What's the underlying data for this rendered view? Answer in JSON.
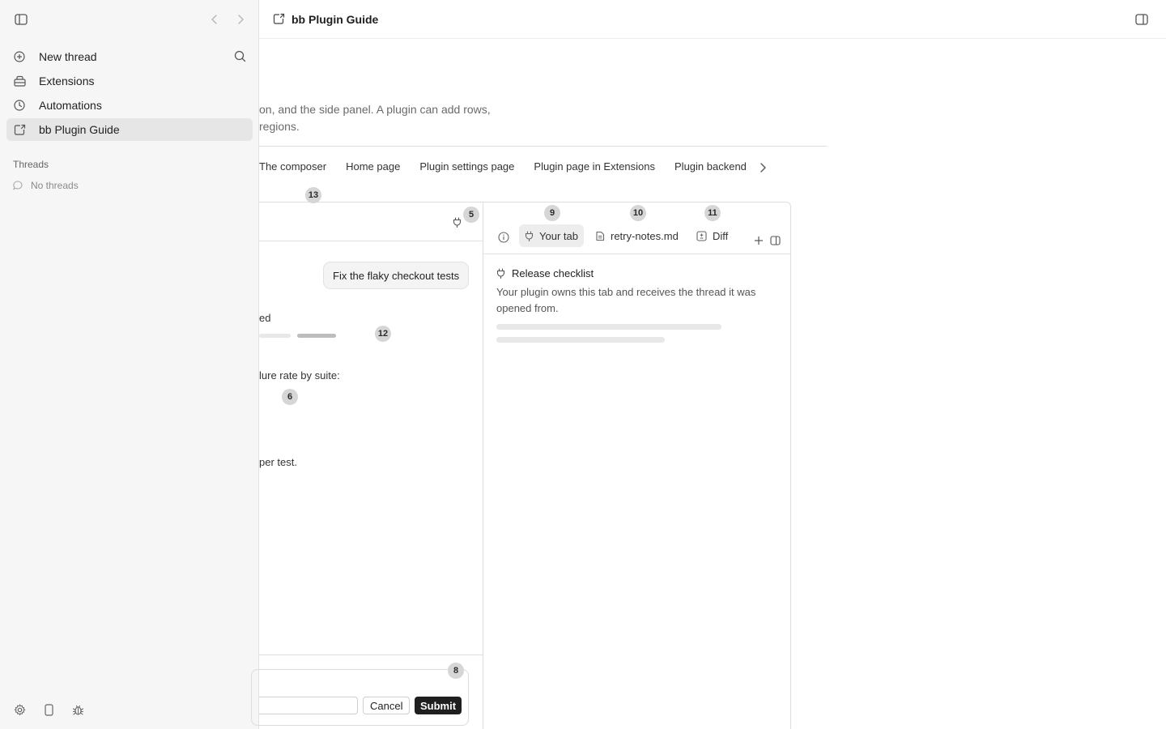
{
  "sidebar": {
    "nav": [
      {
        "label": "New thread",
        "icon": "plus-circle-icon"
      },
      {
        "label": "Extensions",
        "icon": "extensions-icon"
      },
      {
        "label": "Automations",
        "icon": "clock-icon"
      },
      {
        "label": "bb Plugin Guide",
        "icon": "plugin-page-icon",
        "active": true
      }
    ],
    "threads_heading": "Threads",
    "no_threads": "No threads"
  },
  "header": {
    "title": "bb Plugin Guide"
  },
  "main": {
    "description_line1": "on, and the side panel. A plugin can add rows,",
    "description_line2": "regions.",
    "tabs": [
      {
        "label": "The composer"
      },
      {
        "label": "Home page"
      },
      {
        "label": "Plugin settings page"
      },
      {
        "label": "Plugin page in Extensions"
      },
      {
        "label": "Plugin backend"
      }
    ]
  },
  "badges": {
    "b5": "5",
    "b6": "6",
    "b8": "8",
    "b9": "9",
    "b10": "10",
    "b11": "11",
    "b12": "12",
    "b13": "13"
  },
  "thread_preview": {
    "user_message": "Fix the flaky checkout tests",
    "fragment_1": "ed",
    "fragment_2": "lure rate by suite:",
    "fragment_3": "per test.",
    "composer": {
      "cancel_label": "Cancel",
      "submit_label": "Submit"
    }
  },
  "side_panel": {
    "tabs": [
      {
        "label": "Your tab",
        "icon": "plug-icon",
        "active": true
      },
      {
        "label": "retry-notes.md",
        "icon": "file-icon"
      },
      {
        "label": "Diff",
        "icon": "diff-icon"
      }
    ],
    "body_title": "Release checklist",
    "body_text": "Your plugin owns this tab and receives the thread it was opened from."
  },
  "colors": {
    "sidebar_bg": "#f6f6f6",
    "accent_dark": "#1f1f1f",
    "badge_bg": "#d6d6d6"
  }
}
